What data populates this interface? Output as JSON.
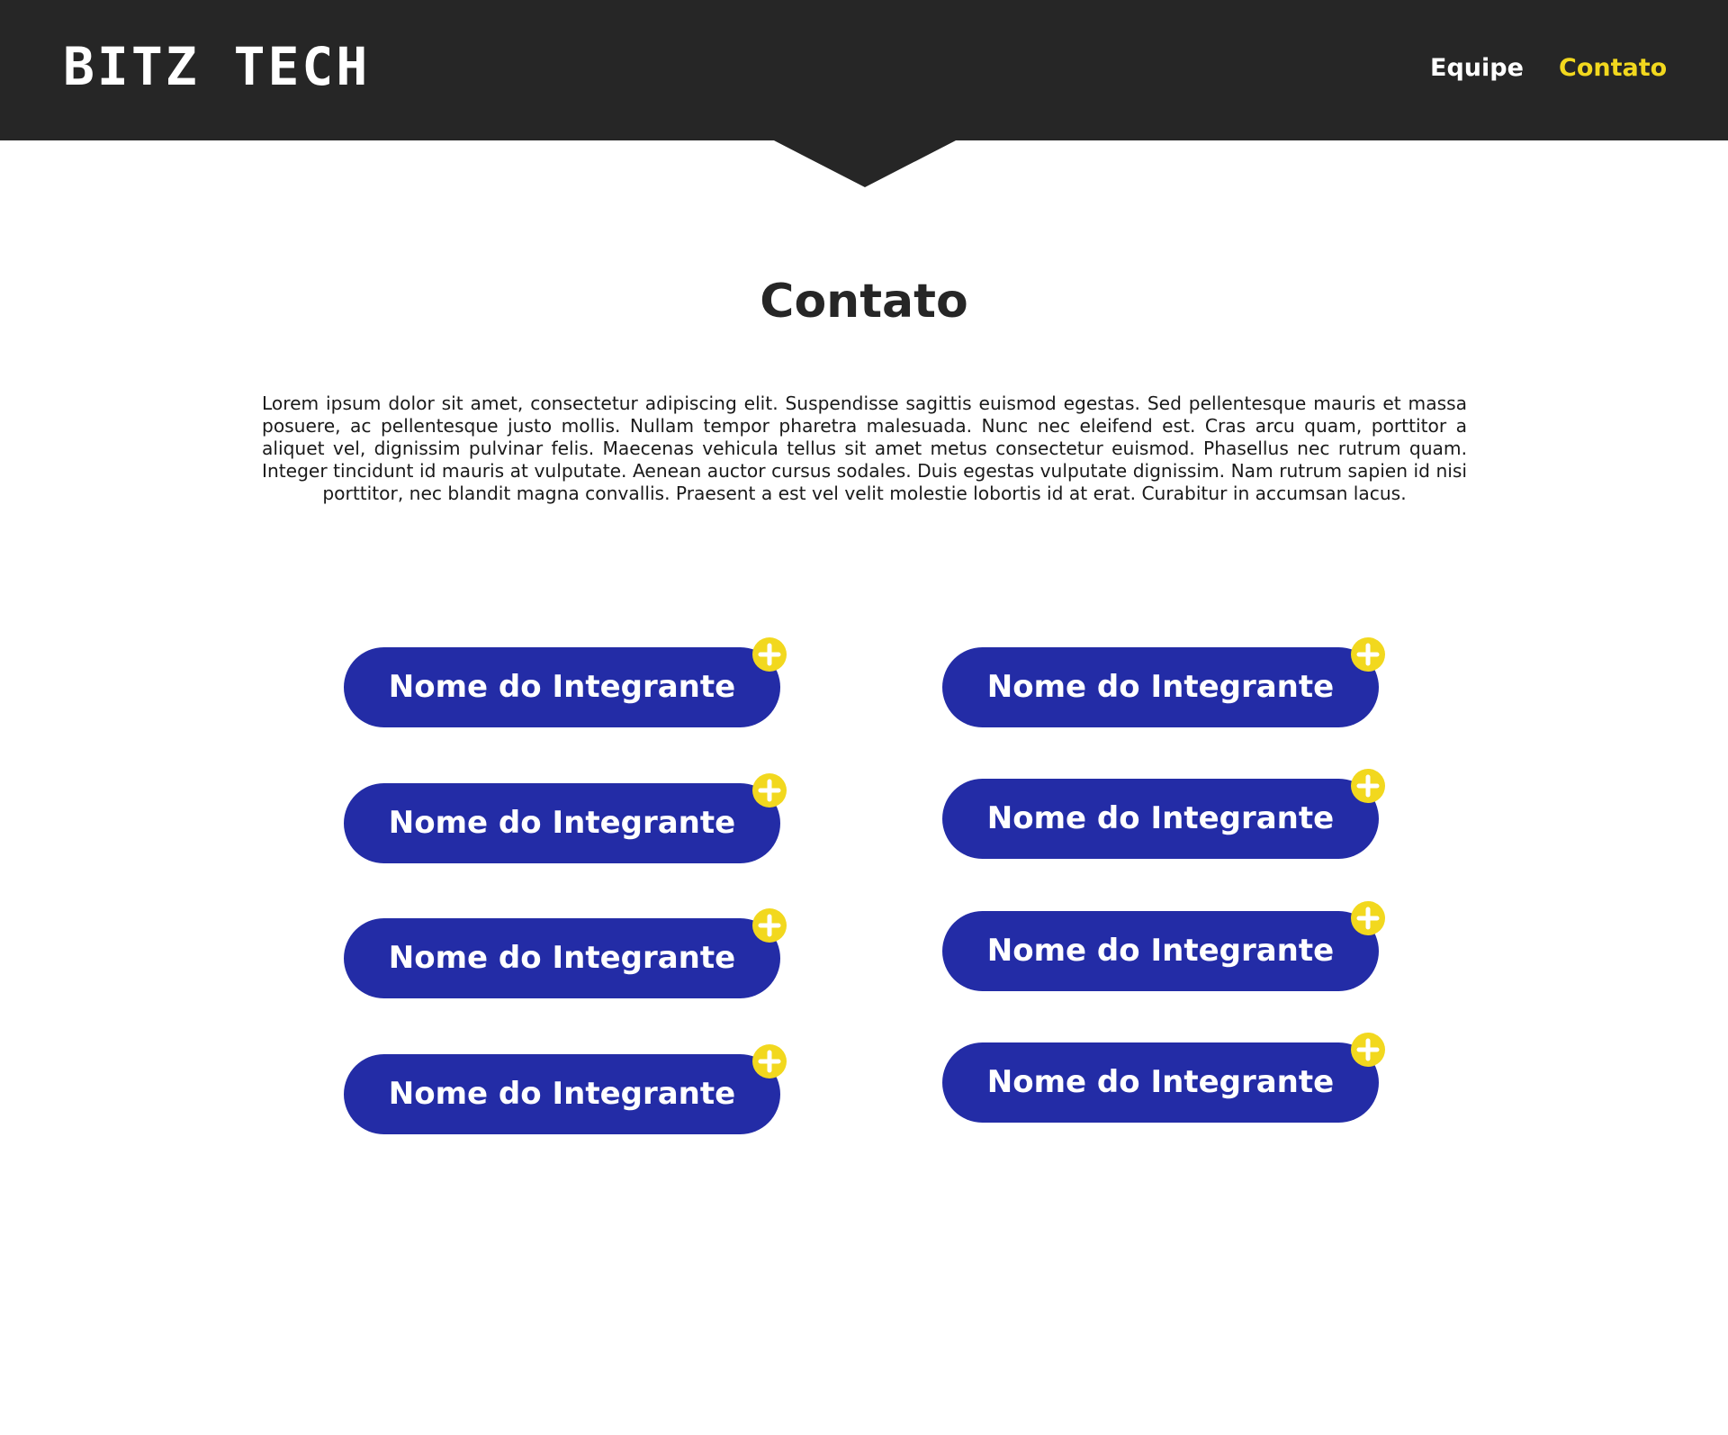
{
  "header": {
    "logo": "BITZ TECH",
    "nav": [
      {
        "label": "Equipe",
        "active": false
      },
      {
        "label": "Contato",
        "active": true
      }
    ]
  },
  "contact": {
    "title": "Contato",
    "description": "Lorem ipsum dolor sit amet, consectetur adipiscing elit. Suspendisse sagittis euismod egestas. Sed pellentesque mauris et massa posuere, ac pellentesque justo mollis. Nullam tempor pharetra malesuada. Nunc nec eleifend est. Cras arcu quam, porttitor a aliquet vel, dignissim pulvinar felis. Maecenas vehicula tellus sit amet metus consectetur euismod. Phasellus nec rutrum quam. Integer tincidunt id mauris at vulputate. Aenean auctor cursus sodales. Duis egestas vulputate dignissim. Nam rutrum sapien id nisi porttitor, nec blandit magna convallis. Praesent a est vel velit molestie lobortis id at erat. Curabitur in accumsan lacus.",
    "members": [
      {
        "label": "Nome do Integrante",
        "icon": "plus-icon"
      },
      {
        "label": "Nome do Integrante",
        "icon": "plus-icon"
      },
      {
        "label": "Nome do Integrante",
        "icon": "plus-icon"
      },
      {
        "label": "Nome do Integrante",
        "icon": "plus-icon"
      },
      {
        "label": "Nome do Integrante",
        "icon": "plus-icon"
      },
      {
        "label": "Nome do Integrante",
        "icon": "plus-icon"
      },
      {
        "label": "Nome do Integrante",
        "icon": "plus-icon"
      },
      {
        "label": "Nome do Integrante",
        "icon": "plus-icon"
      }
    ]
  },
  "colors": {
    "header_bg": "#262626",
    "accent_yellow": "#f2d81e",
    "button_blue": "#232ca6",
    "text_dark": "#262626"
  }
}
